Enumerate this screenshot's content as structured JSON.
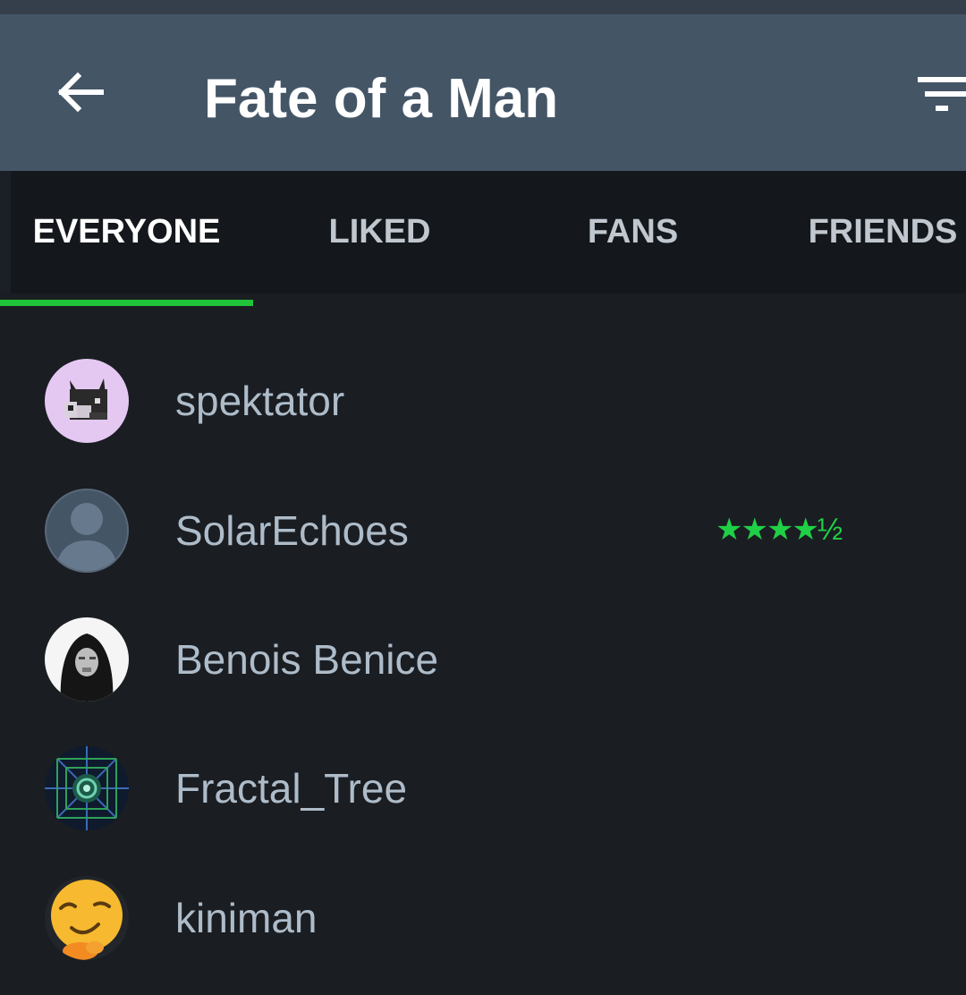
{
  "header": {
    "title": "Fate of a Man"
  },
  "tabs": [
    {
      "label": "EVERYONE",
      "active": true
    },
    {
      "label": "LIKED",
      "active": false
    },
    {
      "label": "FANS",
      "active": false
    },
    {
      "label": "FRIENDS",
      "active": false
    }
  ],
  "members": [
    {
      "name": "spektator",
      "rating": "",
      "avatar": "cat-avatar"
    },
    {
      "name": "SolarEchoes",
      "rating": "★★★★½",
      "avatar": "default-person-avatar"
    },
    {
      "name": "Benois Benice",
      "rating": "",
      "avatar": "hooded-figure-avatar"
    },
    {
      "name": "Fractal_Tree",
      "rating": "",
      "avatar": "fractal-avatar"
    },
    {
      "name": "kiniman",
      "rating": "",
      "avatar": "smirk-emoji-avatar"
    }
  ],
  "colors": {
    "app_bar": "#445566",
    "background": "#1a1d22",
    "tab_bar": "#14181c",
    "accent_green": "#20c43a",
    "rating_green": "#1fd046",
    "member_text": "#aebcc9"
  },
  "icons": {
    "back": "arrow-left-icon",
    "filter": "filter-icon"
  }
}
